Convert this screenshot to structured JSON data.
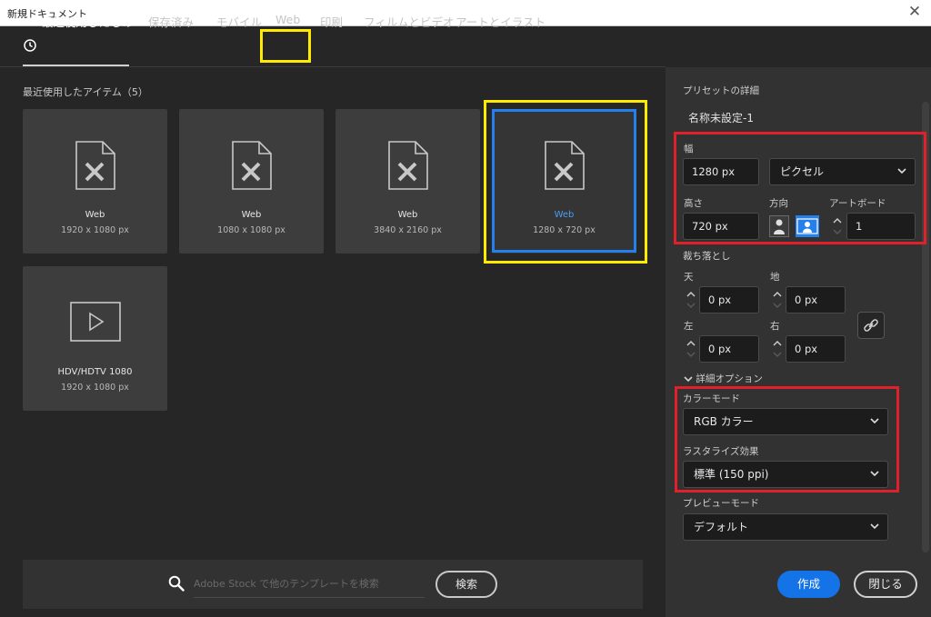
{
  "window": {
    "title": "新規ドキュメント",
    "close_glyph": "✕"
  },
  "tabs": [
    {
      "label": "最近使用したもの",
      "active": true
    },
    {
      "label": "保存済み"
    },
    {
      "label": "モバイル"
    },
    {
      "label": "Web"
    },
    {
      "label": "印刷"
    },
    {
      "label": "フィルムとビデオ"
    },
    {
      "label": "アートとイラスト"
    }
  ],
  "recent": {
    "label": "最近使用したアイテム（5）",
    "items": [
      {
        "title": "Web",
        "size": "1920 x 1080 px",
        "icon": "document-icon"
      },
      {
        "title": "Web",
        "size": "1080 x 1080 px",
        "icon": "document-icon"
      },
      {
        "title": "Web",
        "size": "3840 x 2160 px",
        "icon": "document-icon"
      },
      {
        "title": "Web",
        "size": "1280 x 720 px",
        "icon": "document-icon",
        "selected": true
      },
      {
        "title": "HDV/HDTV 1080",
        "size": "1920 x 1080 px",
        "icon": "video-icon"
      }
    ]
  },
  "search": {
    "placeholder": "Adobe Stock で他のテンプレートを検索",
    "button": "検索"
  },
  "details": {
    "header": "プリセットの詳細",
    "name": "名称未設定-1",
    "width_label": "幅",
    "width_value": "1280 px",
    "unit": "ピクセル",
    "height_label": "高さ",
    "height_value": "720 px",
    "orientation_label": "方向",
    "artboard_label": "アートボード",
    "artboard_value": "1",
    "bleed_label": "裁ち落とし",
    "bleed": {
      "top_label": "天",
      "top": "0 px",
      "bottom_label": "地",
      "bottom": "0 px",
      "left_label": "左",
      "left": "0 px",
      "right_label": "右",
      "right": "0 px"
    },
    "advanced_label": "詳細オプション",
    "color_mode_label": "カラーモード",
    "color_mode": "RGB カラー",
    "raster_label": "ラスタライズ効果",
    "raster": "標準 (150 ppi)",
    "preview_label": "プレビューモード",
    "preview": "デフォルト"
  },
  "buttons": {
    "create": "作成",
    "close": "閉じる"
  },
  "colors": {
    "accent": "#1473e6",
    "selection": "#2680eb",
    "highlight_yellow": "#ffea00",
    "highlight_red": "#e0202a"
  }
}
